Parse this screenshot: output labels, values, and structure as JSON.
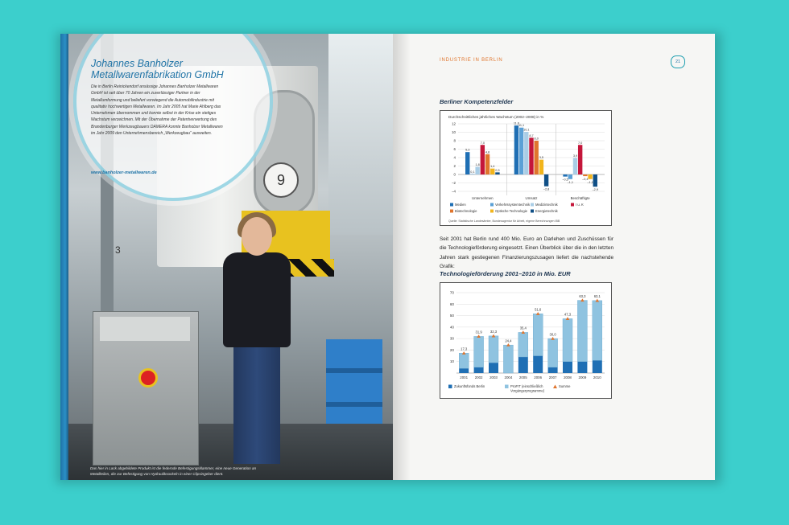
{
  "left_page": {
    "company_title_line1": "Johannes Banholzer",
    "company_title_line2": "Metallwarenfabrikation GmbH",
    "company_text": "Die in Berlin Reinickendorf ansässige Johannes Banholzer Metallwaren GmbH ist seit über 70 Jahren ein zuverlässiger Partner in der Metallumformung und beliefert vorwiegend die Automobilindustrie mit qualitativ hochwertigen Metallwaren. Im Jahr 2005 hat Marie Ahlberg das Unternehmen übernommen und konnte selbst in der Krise ein stetiges Wachstum verzeichnen. Mit der Übernahme der Patentverwertung des Brandenburger Werkzeugbauers DAMERA konnte Banholzer Metallwaren im Jahr 2009 den Unternehmensbereich „Werkzeugbau“ ausweiten.",
    "company_url": "www.banholzer-metallwaren.de",
    "caption": "Das hier in Lack abgebildete Produkt ist die federnde Befestigungsklammer, eine neue Generation an Metallteilen, die zur Befestigung von Hydrauliksockeln in einer Clipsingeber dient.",
    "gauge_label": "9",
    "machine_label": "3"
  },
  "right_page": {
    "running_head": "Industrie in Berlin",
    "page_number": "21",
    "section1_title": "Berliner Kompetenzfelder",
    "body_text": "Seit 2001 hat Berlin rund 400 Mio. Euro an Darlehen und Zuschüssen für die Technologieförderung eingesetzt. Einen Überblick über die in den letzten Jahren stark gestiegenen Finanzierungszusagen liefert die nachstehende Grafik:",
    "section2_title": "Technologieförderung 2001–2010 in Mio. EUR"
  },
  "colors": {
    "background": "#3ccfcc",
    "accent_orange": "#e0752d",
    "title_blue": "#1f73a6"
  },
  "chart_data": [
    {
      "type": "bar",
      "title": "Durchschnittliches jährliches Wachstum (2002–2008) in %",
      "categories": [
        "Unternehmen",
        "Umsatz",
        "Beschäftigte"
      ],
      "ylim": [
        -4,
        12
      ],
      "yticks": [
        "12",
        "10",
        "8",
        "6",
        "4",
        "2",
        "0",
        "–2",
        "–4"
      ],
      "series": [
        {
          "name": "Medien",
          "color": "#1f6fb4",
          "values": [
            5.3,
            11.6,
            -0.5
          ],
          "labels": [
            "5,3",
            "11,6",
            "–0,5"
          ]
        },
        {
          "name": "Verkehrssystemtechnik",
          "color": "#5aa0d6",
          "values": [
            0.1,
            11.1,
            -1.1
          ],
          "labels": [
            "0,1",
            "11,1",
            "–1,1"
          ]
        },
        {
          "name": "Medizintechnik",
          "color": "#a9cde6",
          "values": [
            1.8,
            10.1,
            3.9
          ],
          "labels": [
            "1,8",
            "10,1",
            "3,9"
          ]
        },
        {
          "name": "I u. K",
          "color": "#c4163a",
          "values": [
            7.0,
            8.7,
            7.0
          ],
          "labels": [
            "7,0",
            "8,7",
            "7,0"
          ]
        },
        {
          "name": "Biotechnologie",
          "color": "#e0752d",
          "values": [
            4.8,
            8.0,
            -0.4
          ],
          "labels": [
            "4,8",
            "8,0",
            "–0,4"
          ]
        },
        {
          "name": "Optische Technologie",
          "color": "#f2b51c",
          "values": [
            1.4,
            3.5,
            -1.1
          ],
          "labels": [
            "1,4",
            "3,5",
            "–1,1"
          ]
        },
        {
          "name": "Energietechnik",
          "color": "#0f4f86",
          "values": [
            0.5,
            -2.8,
            -2.9
          ],
          "labels": [
            "0,5",
            "–2,8",
            "–2,9"
          ]
        }
      ],
      "source": "Quelle: Statistische Landesämter, Bundesagentur für Arbeit, eigene Berechnungen IBB"
    },
    {
      "type": "bar",
      "title": "",
      "categories": [
        "2001",
        "2002",
        "2003",
        "2004",
        "2005",
        "2006",
        "2007",
        "2008",
        "2009",
        "2010"
      ],
      "ylim": [
        0,
        70
      ],
      "yticks": [
        "70",
        "60",
        "50",
        "40",
        "30",
        "20",
        "10"
      ],
      "series": [
        {
          "name": "Zukunftsfonds Berlin",
          "color": "#1f6fb4",
          "values": [
            4,
            5,
            9,
            0,
            14,
            15,
            5,
            10,
            10,
            11
          ]
        },
        {
          "name": "ProFIT (einschließlich Vorgängerprogramme)",
          "color": "#8fc3e0",
          "values": [
            13.3,
            26.9,
            23.3,
            24.4,
            21.4,
            36.6,
            25.0,
            37.3,
            53.3,
            52.1
          ]
        },
        {
          "name": "Summe",
          "color": "#e0752d",
          "values": [
            17.3,
            31.9,
            32.3,
            24.4,
            35.4,
            51.6,
            30.0,
            47.3,
            63.3,
            63.1
          ],
          "labels": [
            "17,3",
            "31,9",
            "32,3",
            "24,4",
            "35,4",
            "51,6",
            "30,0",
            "47,3",
            "63,3",
            "63,1"
          ]
        }
      ]
    }
  ]
}
